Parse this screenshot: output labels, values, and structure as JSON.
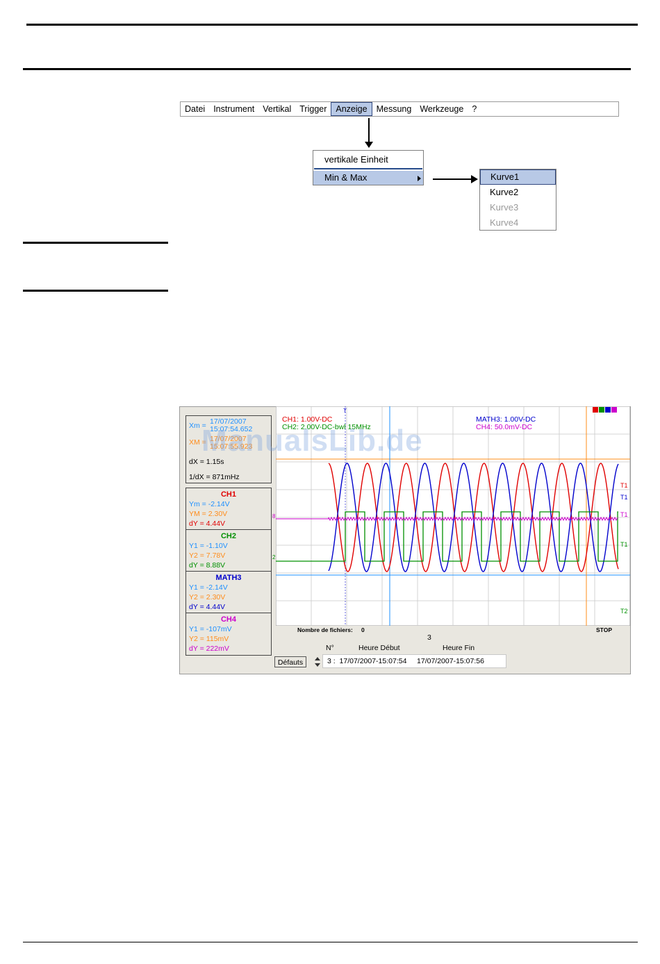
{
  "menu": {
    "items": [
      "Datei",
      "Instrument",
      "Vertikal",
      "Trigger",
      "Anzeige",
      "Messung",
      "Werkzeuge",
      "?"
    ],
    "active_index": 4
  },
  "dropdown": {
    "item1": "vertikale Einheit",
    "item2": "Min & Max"
  },
  "submenu": {
    "items": [
      "Kurve1",
      "Kurve2",
      "Kurve3",
      "Kurve4"
    ]
  },
  "watermark": "ManualsLib.de",
  "cursors": {
    "xm_label": "Xm =",
    "xm_date": "17/07/2007",
    "xm_time": "15:07:54.652",
    "xM_label": "XM =",
    "xM_date": "17/07/2007",
    "xM_time": "15:07:55.923",
    "dx": "dX = 1.15s",
    "inv_dx": "1/dX = 871mHz"
  },
  "channels": {
    "ch1": {
      "name": "CH1",
      "l1": "Ym = -2.14V",
      "l2": "YM = 2.30V",
      "l3": "dY = 4.44V"
    },
    "ch2": {
      "name": "CH2",
      "l1": "Y1 = -1.10V",
      "l2": "Y2 = 7.78V",
      "l3": "dY = 8.88V"
    },
    "math3": {
      "name": "MATH3",
      "l1": "Y1 = -2.14V",
      "l2": "Y2 = 2.30V",
      "l3": "dY = 4.44V"
    },
    "ch4": {
      "name": "CH4",
      "l1": "Y1 = -107mV",
      "l2": "Y2 = 115mV",
      "l3": "dY = 222mV"
    }
  },
  "plot": {
    "ch1_setting": "CH1: 1.00V-DC",
    "ch2_setting": "CH2: 2.00V-DC-bwl 15MHz",
    "math3_setting": "MATH3: 1.00V-DC",
    "ch4_setting": "CH4: 50.0mV-DC",
    "files_label": "Nombre de fichiers:",
    "files_count": "0",
    "status": "STOP",
    "marker_t": "T",
    "marker_t1": "T1",
    "marker_t2": "T2",
    "marker_8": "8",
    "marker_2": "2"
  },
  "records": {
    "count": "3",
    "col_n": "N°",
    "col_start": "Heure Début",
    "col_end": "Heure Fin",
    "defaults_button": "Défauts",
    "row": "3 :  17/07/2007-15:07:54     17/07/2007-15:07:56"
  },
  "colors": {
    "ch1": "#e00000",
    "ch2": "#009000",
    "math3": "#0000cc",
    "ch4": "#cc00cc",
    "cursor_x": "#1e90ff",
    "cursor_orange": "#ff8c1a"
  }
}
